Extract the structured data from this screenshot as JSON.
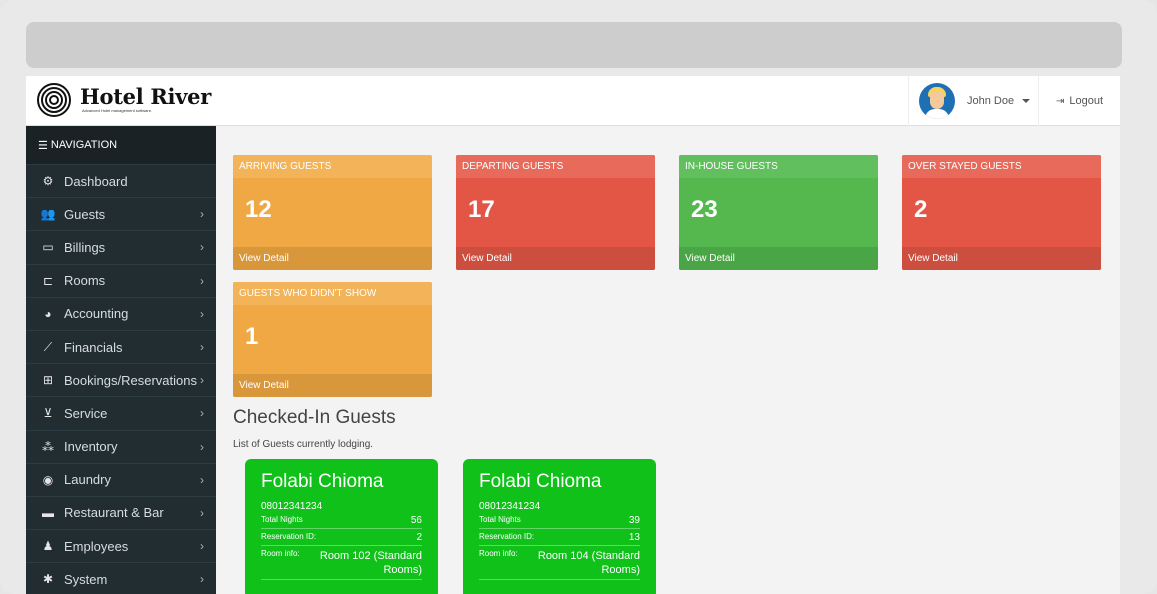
{
  "app": {
    "logo_title": "Hotel River",
    "logo_subtitle": "Advanced Hotel management software."
  },
  "header": {
    "user_name": "John Doe",
    "logout_label": "Logout"
  },
  "sidebar": {
    "heading": "NAVIGATION",
    "items": [
      {
        "label": "Dashboard",
        "icon": "dashboard-icon",
        "glyph": "⚙",
        "has_children": false
      },
      {
        "label": "Guests",
        "icon": "users-icon",
        "glyph": "👥",
        "has_children": true
      },
      {
        "label": "Billings",
        "icon": "credit-card-icon",
        "glyph": "▭",
        "has_children": true
      },
      {
        "label": "Rooms",
        "icon": "bed-icon",
        "glyph": "⊏",
        "has_children": true
      },
      {
        "label": "Accounting",
        "icon": "pie-chart-icon",
        "glyph": "◕",
        "has_children": true
      },
      {
        "label": "Financials",
        "icon": "line-chart-icon",
        "glyph": "⟋",
        "has_children": true
      },
      {
        "label": "Bookings/Reservations",
        "icon": "sitemap-icon",
        "glyph": "⊞",
        "has_children": true
      },
      {
        "label": "Service",
        "icon": "cart-icon",
        "glyph": "⊻",
        "has_children": true
      },
      {
        "label": "Inventory",
        "icon": "hierarchy-icon",
        "glyph": "⁂",
        "has_children": true
      },
      {
        "label": "Laundry",
        "icon": "laundry-icon",
        "glyph": "◉",
        "has_children": true
      },
      {
        "label": "Restaurant & Bar",
        "icon": "restaurant-icon",
        "glyph": "▬",
        "has_children": true
      },
      {
        "label": "Employees",
        "icon": "user-plus-icon",
        "glyph": "♟",
        "has_children": true
      },
      {
        "label": "System",
        "icon": "cog-icon",
        "glyph": "✱",
        "has_children": true
      }
    ]
  },
  "stats": [
    {
      "title": "ARRIVING GUESTS",
      "value": "12",
      "link": "View Detail",
      "color": "orange"
    },
    {
      "title": "DEPARTING GUESTS",
      "value": "17",
      "link": "View Detail",
      "color": "red"
    },
    {
      "title": "IN-HOUSE GUESTS",
      "value": "23",
      "link": "View Detail",
      "color": "green"
    },
    {
      "title": "OVER STAYED GUESTS",
      "value": "2",
      "link": "View Detail",
      "color": "red"
    },
    {
      "title": "GUESTS WHO DIDN'T SHOW",
      "value": "1",
      "link": "View Detail",
      "color": "orange"
    }
  ],
  "checked_in": {
    "title": "Checked-In Guests",
    "subtitle": "List of Guests currently lodging.",
    "guests": [
      {
        "name": "Folabi Chioma",
        "phone": "08012341234",
        "nights_label": "Total Nights",
        "nights": "56",
        "res_label": "Reservation ID:",
        "res_id": "2",
        "room_label": "Room info:",
        "room": "Room 102 (Standard Rooms)"
      },
      {
        "name": "Folabi Chioma",
        "phone": "08012341234",
        "nights_label": "Total Nights",
        "nights": "39",
        "res_label": "Reservation ID:",
        "res_id": "13",
        "room_label": "Room info:",
        "room": "Room 104 (Standard Rooms)"
      }
    ]
  },
  "colors": {
    "sidebar_bg": "#222d32",
    "orange": "#f0a844",
    "red": "#e35645",
    "green": "#54b84f",
    "guest_card": "#10c11a"
  }
}
